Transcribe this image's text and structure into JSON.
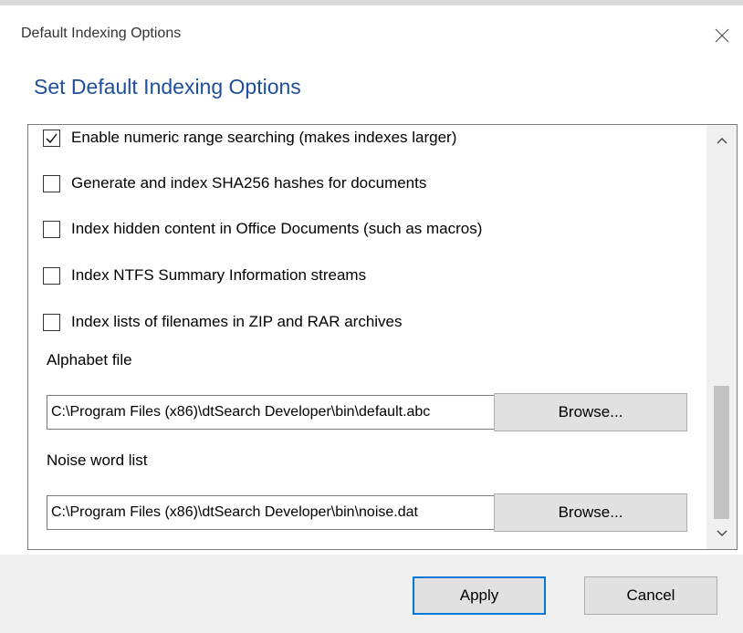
{
  "window": {
    "title": "Default Indexing Options",
    "close_icon": "close-icon"
  },
  "heading": "Set Default Indexing Options",
  "options": [
    {
      "label": "Enable numeric range searching (makes indexes larger)",
      "checked": true
    },
    {
      "label": "Generate and index SHA256 hashes for documents",
      "checked": false
    },
    {
      "label": "Index hidden content in Office Documents (such as macros)",
      "checked": false
    },
    {
      "label": "Index NTFS Summary Information streams",
      "checked": false
    },
    {
      "label": "Index lists of filenames in ZIP and RAR archives",
      "checked": false
    }
  ],
  "alphabet": {
    "label": "Alphabet file",
    "value": "C:\\Program Files (x86)\\dtSearch Developer\\bin\\default.abc",
    "browse_label": "Browse..."
  },
  "noise": {
    "label": "Noise word list",
    "value": "C:\\Program Files (x86)\\dtSearch Developer\\bin\\noise.dat",
    "browse_label": "Browse..."
  },
  "scrollbar": {
    "up_icon": "chevron-up-icon",
    "down_icon": "chevron-down-icon",
    "position": 0.75
  },
  "footer": {
    "apply_label": "Apply",
    "cancel_label": "Cancel"
  },
  "colors": {
    "heading": "#1f4e9c",
    "default_button_border": "#0078d7",
    "footer_bg": "#f0f0f0"
  }
}
